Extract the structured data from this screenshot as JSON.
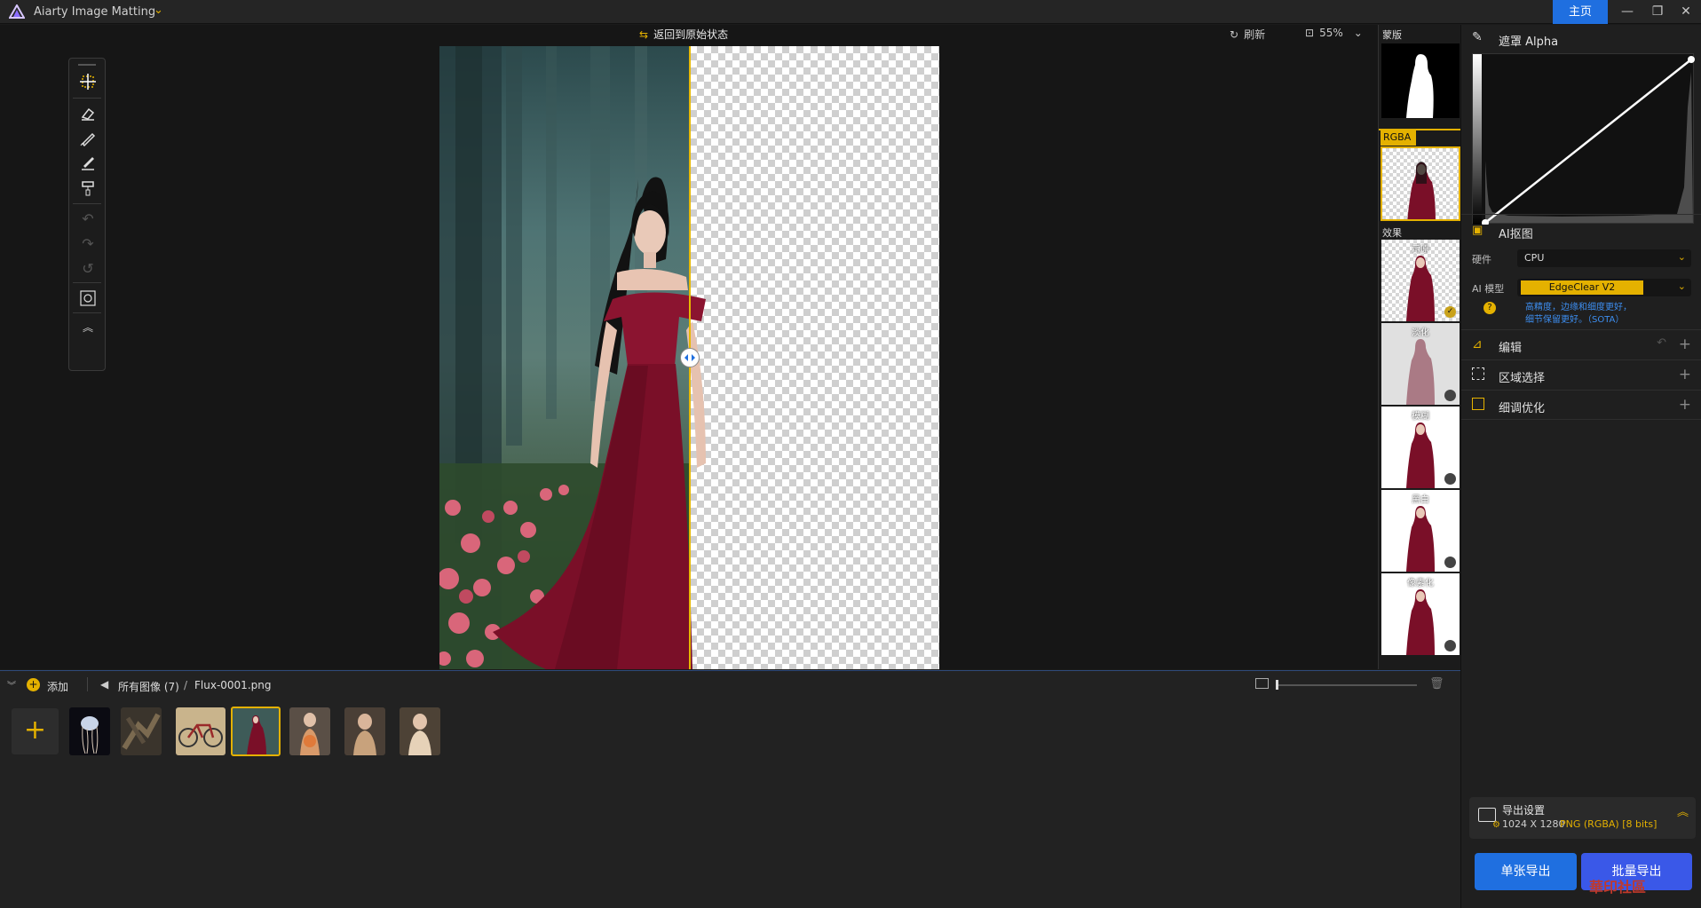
{
  "titlebar": {
    "app_title": "Aiarty Image Matting",
    "home_label": "主页",
    "minimize": "—",
    "maximize": "❐",
    "close": "✕"
  },
  "canvas": {
    "restore_label": "返回到原始状态",
    "refresh_label": "刷新",
    "zoom_value": "55%"
  },
  "preview_strip": {
    "mask_label": "蒙版",
    "rgba_label": "RGBA",
    "effects_label": "效果",
    "effects": [
      {
        "label": "示原",
        "selected": true
      },
      {
        "label": "淡化",
        "selected": false
      },
      {
        "label": "模糊",
        "selected": false
      },
      {
        "label": "黑白",
        "selected": false
      },
      {
        "label": "像素化",
        "selected": false
      }
    ]
  },
  "right_panel": {
    "alpha_title": "遮罩 Alpha",
    "ai_title": "AI抠图",
    "hardware_label": "硬件",
    "hardware_value": "CPU",
    "model_label": "AI 模型",
    "model_value": "EdgeClear  V2",
    "model_desc_1": "高精度，边缘和细度更好，",
    "model_desc_2": "细节保留更好。（SOTA）",
    "help_glyph": "?",
    "sections": [
      {
        "label": "编辑"
      },
      {
        "label": "区域选择"
      },
      {
        "label": "细调优化"
      }
    ],
    "export_settings_title": "导出设置",
    "export_size": "1024 X 1280",
    "export_format": "PNG (RGBA) [8 bits]",
    "single_export": "单张导出",
    "batch_export": "批量导出"
  },
  "bottom": {
    "add_label": "添加",
    "all_images": "所有图像 (7)",
    "separator": "/",
    "current_file": "Flux-0001.png",
    "add_tile_glyph": "+"
  },
  "colors": {
    "accent": "#e4b100",
    "primary_blue": "#1f6fe0",
    "batch_blue": "#3a58e8",
    "background": "#1b1b1b"
  }
}
